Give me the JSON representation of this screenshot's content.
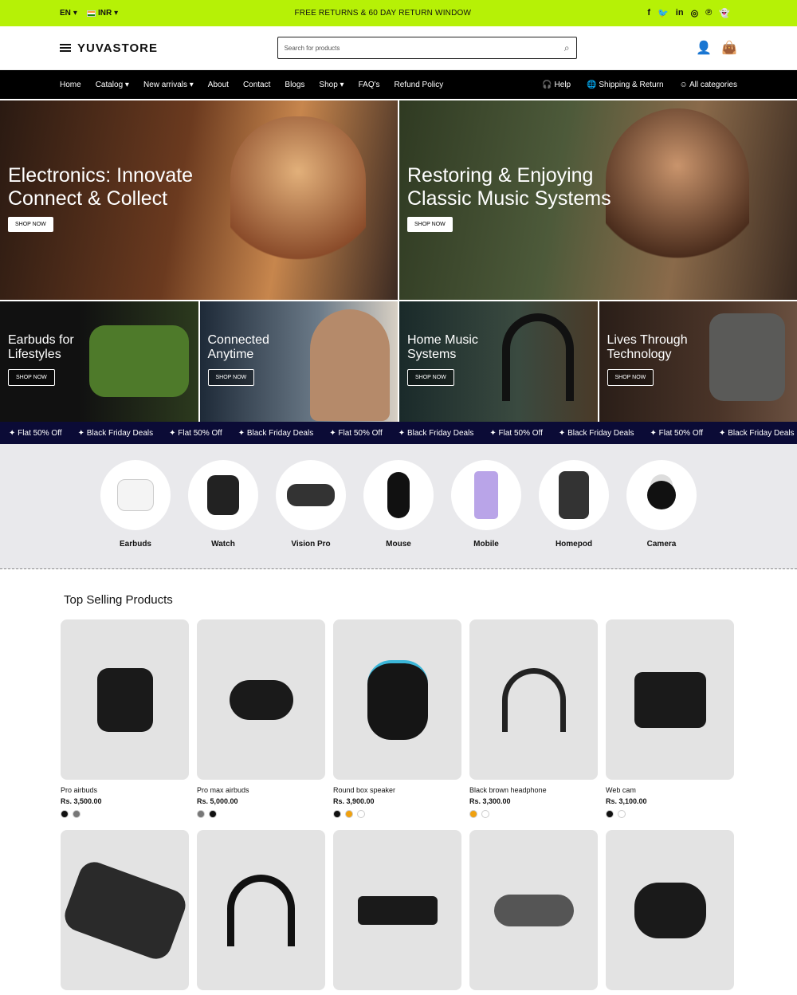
{
  "topbar": {
    "lang": "EN",
    "currency": "INR",
    "announcement": "FREE RETURNS & 60 DAY RETURN WINDOW",
    "social": [
      "f",
      "t",
      "in",
      "ig",
      "p",
      "sc"
    ]
  },
  "header": {
    "logo": "YUVASTORE",
    "search_placeholder": "Search for products"
  },
  "nav": {
    "items": [
      "Home",
      "Catalog",
      "New arrivals",
      "About",
      "Contact",
      "Blogs",
      "Shop",
      "FAQ's",
      "Refund Policy"
    ],
    "right": [
      "Help",
      "Shipping & Return",
      "All categories"
    ]
  },
  "hero": [
    {
      "title1": "Electronics: Innovate",
      "title2": "Connect & Collect",
      "button": "SHOP NOW"
    },
    {
      "title1": "Restoring & Enjoying",
      "title2": "Classic Music Systems",
      "button": "SHOP NOW"
    }
  ],
  "minis": [
    {
      "t1": "Earbuds for",
      "t2": "Lifestyles",
      "button": "SHOP NOW"
    },
    {
      "t1": "Connected",
      "t2": "Anytime",
      "button": "SHOP NOW"
    },
    {
      "t1": "Home Music",
      "t2": "Systems",
      "button": "SHOP NOW"
    },
    {
      "t1": "Lives Through",
      "t2": "Technology",
      "button": "SHOP NOW"
    }
  ],
  "marquee": [
    "Flat 50% Off",
    "Black Friday Deals",
    "Flat 50% Off",
    "Black Friday Deals",
    "Flat 50% Off",
    "Black Friday Deals",
    "Flat 50% Off",
    "Black Friday Deals",
    "Flat 50% Off",
    "Black Friday Deals"
  ],
  "categories": [
    "Earbuds",
    "Watch",
    "Vision Pro",
    "Mouse",
    "Mobile",
    "Homepod",
    "Camera"
  ],
  "section_title": "Top Selling Products",
  "products": [
    {
      "name": "Pro airbuds",
      "price": "Rs. 3,500.00",
      "swatches": [
        "#111",
        "#777"
      ]
    },
    {
      "name": "Pro max airbuds",
      "price": "Rs. 5,000.00",
      "swatches": [
        "#777",
        "#111"
      ]
    },
    {
      "name": "Round box speaker",
      "price": "Rs. 3,900.00",
      "swatches": [
        "#111",
        "#f0a10f",
        "#fff"
      ]
    },
    {
      "name": "Black brown headphone",
      "price": "Rs. 3,300.00",
      "swatches": [
        "#f0a10f",
        "#fff"
      ]
    },
    {
      "name": "Web cam",
      "price": "Rs. 3,100.00",
      "swatches": [
        "#111",
        "#fff"
      ]
    }
  ],
  "colors": {
    "accent": "#b6f106",
    "nav": "#000000",
    "marquee": "#0b0b36"
  }
}
